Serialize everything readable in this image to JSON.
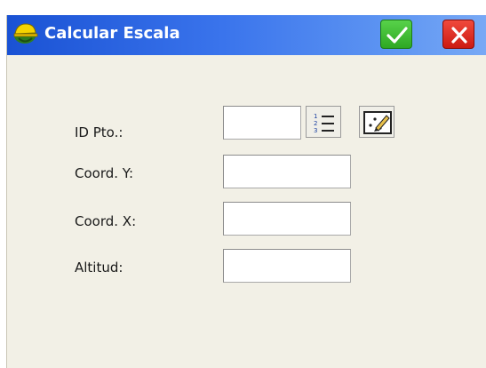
{
  "window": {
    "title": "Calcular Escala",
    "ok_icon": "checkmark-icon",
    "close_icon": "close-x-icon",
    "app_icon": "surveyor-helmet-icon"
  },
  "form": {
    "id_label": "ID Pto.:",
    "id_value": "",
    "list_icon": "numbered-list-icon",
    "map_icon": "map-select-icon",
    "y_label": "Coord. Y:",
    "y_value": "",
    "x_label": "Coord. X:",
    "x_value": "",
    "alt_label": "Altitud:",
    "alt_value": ""
  },
  "colors": {
    "titlebar": "#2f6ae6",
    "ok": "#3cb82f",
    "close": "#e0261a",
    "background": "#f2f0e6"
  }
}
